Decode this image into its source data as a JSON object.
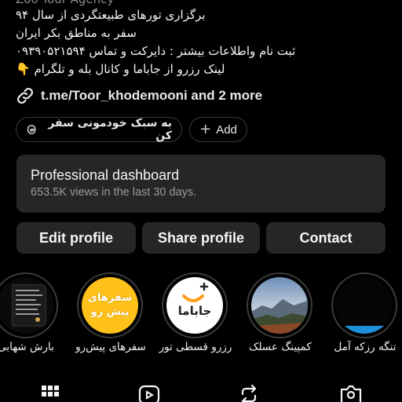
{
  "profile": {
    "category": "Zoo Tour Agency",
    "bio_lines": [
      "برگزاری تورهای طبیعتگردی از سال ۹۴",
      "سفر به مناطق بکر ایران",
      "ثبت نام واطلاعات بیشتر : دایرکت و تماس ۰۹۳۹۰۵۲۱۵۹۴",
      "لینک رزرو از جاباما و کانال بله و تلگرام 👇"
    ],
    "link_text": "t.me/Toor_khodemooni and 2 more"
  },
  "chips": {
    "travel_label": "به سبک خودمونی سفر کن",
    "add_label": "Add"
  },
  "dashboard": {
    "title": "Professional dashboard",
    "subtitle": "653.5K views in the last 30 days."
  },
  "buttons": {
    "edit": "Edit profile",
    "share": "Share profile",
    "contact": "Contact"
  },
  "highlights": [
    {
      "label": "بارش شهابی"
    },
    {
      "label": "سفرهای پیش‌رو",
      "badge": "سفرهای پیش رو"
    },
    {
      "label": "رزرو قسطی تور",
      "badge": "جاباما"
    },
    {
      "label": "کمپینگ عسلک"
    },
    {
      "label": "تنگه رزکه آمل"
    }
  ],
  "colors": {
    "background": "#000000",
    "card": "#262626",
    "accent_yellow": "#ffc21a"
  },
  "tabs": [
    "grid-icon",
    "reels-icon",
    "reposts-icon",
    "tagged-icon"
  ]
}
